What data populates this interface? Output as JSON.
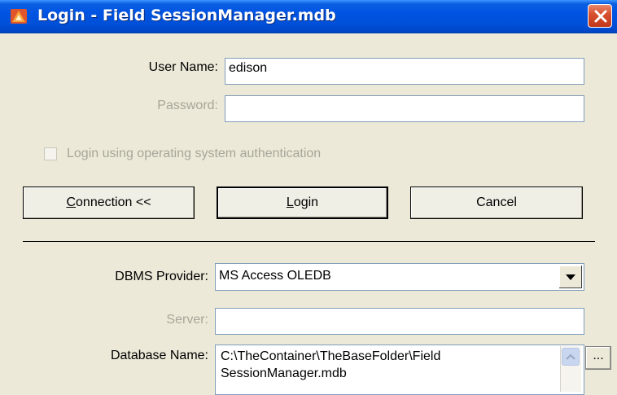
{
  "window": {
    "title": "Login - Field SessionManager.mdb",
    "close_label": "×"
  },
  "form": {
    "user_name_label": "User Name:",
    "user_name_value": "edison",
    "password_label": "Password:",
    "password_value": "",
    "os_auth_label": "Login using operating system authentication",
    "os_auth_checked": false
  },
  "buttons": {
    "connection_prefix": "C",
    "connection_rest": "onnection <<",
    "login_prefix": "L",
    "login_rest": "ogin",
    "cancel_label": "Cancel"
  },
  "connection": {
    "dbms_label": "DBMS Provider:",
    "dbms_value": "MS Access OLEDB",
    "server_label": "Server:",
    "server_value": "",
    "database_label": "Database Name:",
    "database_value_line1": "C:\\TheContainer\\TheBaseFolder\\Field",
    "database_value_line2": "SessionManager.mdb",
    "browse_label": "..."
  },
  "colors": {
    "titlebar": "#0054e3",
    "window_bg": "#ece9d8",
    "close_button": "#d8512f",
    "disabled_text": "#a7a698"
  },
  "icons": {
    "app_icon": "app-icon",
    "close_icon": "close-icon",
    "dropdown_arrow_icon": "chevron-down-icon",
    "scroll_up_icon": "chevron-up-icon"
  }
}
